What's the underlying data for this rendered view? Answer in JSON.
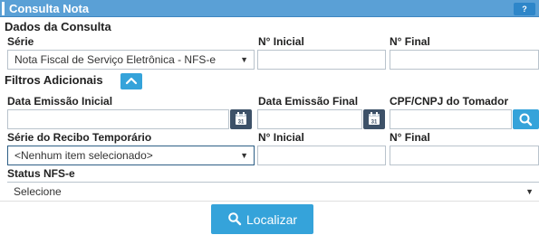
{
  "header": {
    "title": "Consulta Nota",
    "help_label": "?"
  },
  "dados_consulta": {
    "title": "Dados da Consulta",
    "serie_label": "Série",
    "serie_value": "Nota Fiscal de Serviço Eletrônica - NFS-e",
    "num_inicial_label": "N° Inicial",
    "num_inicial_value": "",
    "num_final_label": "N° Final",
    "num_final_value": ""
  },
  "filtros": {
    "title": "Filtros Adicionais",
    "data_inicial_label": "Data Emissão Inicial",
    "data_inicial_value": "",
    "data_final_label": "Data Emissão Final",
    "data_final_value": "",
    "cpf_label": "CPF/CNPJ do Tomador",
    "cpf_value": "",
    "serie_recibo_label": "Série do Recibo Temporário",
    "serie_recibo_value": "<Nenhum item selecionado>",
    "recibo_inicial_label": "N° Inicial",
    "recibo_inicial_value": "",
    "recibo_final_label": "N° Final",
    "recibo_final_value": "",
    "status_label": "Status NFS-e",
    "status_value": "Selecione",
    "calendar_day": "31"
  },
  "actions": {
    "search_label": "Localizar"
  },
  "icons": {
    "calendar": "calendar-icon",
    "search": "search-icon",
    "collapse": "chevron-up-icon",
    "dropdown": "caret-down-icon"
  },
  "colors": {
    "header_bg": "#5aa0d6",
    "primary_button": "#35a3da",
    "calendar_addon": "#3d5168"
  }
}
